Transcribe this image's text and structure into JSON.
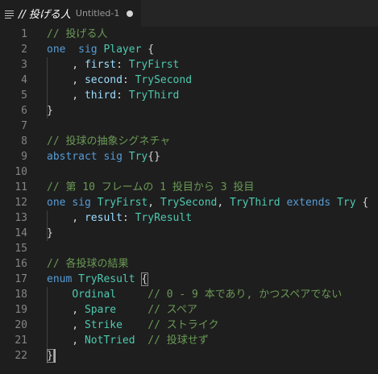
{
  "tab": {
    "title": "// 投げる人",
    "subtitle": "Untitled-1"
  },
  "editor": {
    "lines": [
      {
        "no": "1",
        "segments": [
          [
            "c",
            "// 投げる人"
          ]
        ]
      },
      {
        "no": "2",
        "segments": [
          [
            "k",
            "one"
          ],
          [
            "",
            "  "
          ],
          [
            "k",
            "sig"
          ],
          [
            "",
            " "
          ],
          [
            "t",
            "Player"
          ],
          [
            "",
            " {"
          ]
        ]
      },
      {
        "no": "3",
        "segments": [
          [
            "",
            "    , "
          ],
          [
            "p",
            "first"
          ],
          [
            "",
            ": "
          ],
          [
            "t",
            "TryFirst"
          ]
        ]
      },
      {
        "no": "4",
        "segments": [
          [
            "",
            "    , "
          ],
          [
            "p",
            "second"
          ],
          [
            "",
            ": "
          ],
          [
            "t",
            "TrySecond"
          ]
        ]
      },
      {
        "no": "5",
        "segments": [
          [
            "",
            "    , "
          ],
          [
            "p",
            "third"
          ],
          [
            "",
            ": "
          ],
          [
            "t",
            "TryThird"
          ]
        ]
      },
      {
        "no": "6",
        "segments": [
          [
            "",
            "}"
          ]
        ]
      },
      {
        "no": "7",
        "segments": []
      },
      {
        "no": "8",
        "segments": [
          [
            "c",
            "// 投球の抽象シグネチャ"
          ]
        ]
      },
      {
        "no": "9",
        "segments": [
          [
            "k",
            "abstract"
          ],
          [
            "",
            " "
          ],
          [
            "k",
            "sig"
          ],
          [
            "",
            " "
          ],
          [
            "t",
            "Try"
          ],
          [
            "",
            "{}"
          ]
        ]
      },
      {
        "no": "10",
        "segments": []
      },
      {
        "no": "11",
        "segments": [
          [
            "c",
            "// 第 10 フレームの 1 投目から 3 投目"
          ]
        ]
      },
      {
        "no": "12",
        "segments": [
          [
            "k",
            "one"
          ],
          [
            "",
            " "
          ],
          [
            "k",
            "sig"
          ],
          [
            "",
            " "
          ],
          [
            "t",
            "TryFirst"
          ],
          [
            "",
            ", "
          ],
          [
            "t",
            "TrySecond"
          ],
          [
            "",
            ", "
          ],
          [
            "t",
            "TryThird"
          ],
          [
            "",
            " "
          ],
          [
            "k",
            "extends"
          ],
          [
            "",
            " "
          ],
          [
            "t",
            "Try"
          ],
          [
            "",
            " {"
          ]
        ]
      },
      {
        "no": "13",
        "segments": [
          [
            "",
            "    , "
          ],
          [
            "p",
            "result"
          ],
          [
            "",
            ": "
          ],
          [
            "t",
            "TryResult"
          ]
        ]
      },
      {
        "no": "14",
        "segments": [
          [
            "",
            "}"
          ]
        ]
      },
      {
        "no": "15",
        "segments": []
      },
      {
        "no": "16",
        "segments": [
          [
            "c",
            "// 各投球の結果"
          ]
        ]
      },
      {
        "no": "17",
        "segments": [
          [
            "k",
            "enum"
          ],
          [
            "",
            " "
          ],
          [
            "t",
            "TryResult"
          ],
          [
            "",
            " {"
          ]
        ]
      },
      {
        "no": "18",
        "segments": [
          [
            "",
            "    "
          ],
          [
            "t",
            "Ordinal"
          ],
          [
            "",
            "     "
          ],
          [
            "c",
            "// 0 - 9 本であり, かつスペアでない"
          ]
        ]
      },
      {
        "no": "19",
        "segments": [
          [
            "",
            "    , "
          ],
          [
            "t",
            "Spare"
          ],
          [
            "",
            "     "
          ],
          [
            "c",
            "// スペア"
          ]
        ]
      },
      {
        "no": "20",
        "segments": [
          [
            "",
            "    , "
          ],
          [
            "t",
            "Strike"
          ],
          [
            "",
            "    "
          ],
          [
            "c",
            "// ストライク"
          ]
        ]
      },
      {
        "no": "21",
        "segments": [
          [
            "",
            "    , "
          ],
          [
            "t",
            "NotTried"
          ],
          [
            "",
            "  "
          ],
          [
            "c",
            "// 投球せず"
          ]
        ]
      },
      {
        "no": "22",
        "segments": [
          [
            "",
            "}"
          ]
        ]
      }
    ]
  },
  "colors": {
    "background": "#1e1e1e",
    "keyword": "#569cd6",
    "comment": "#6a9955",
    "type": "#4ec9b0",
    "property": "#9cdcfe",
    "text": "#d4d4d4",
    "line_number": "#858585"
  },
  "icons": {
    "tab_file": "lines-icon",
    "tab_modified": "dot-icon"
  }
}
